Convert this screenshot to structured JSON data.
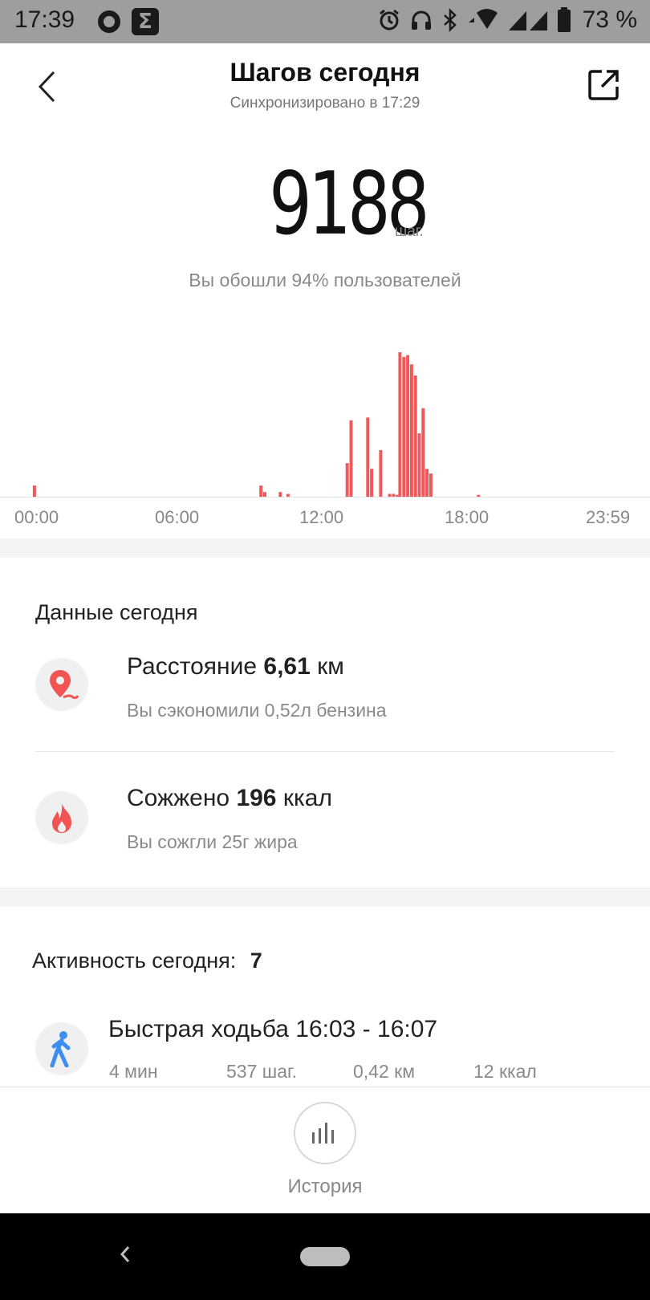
{
  "status_bar": {
    "time": "17:39",
    "battery": "73 %",
    "icons": [
      "ring-app-icon",
      "sigma-app-icon",
      "alarm-icon",
      "headphones-icon",
      "bluetooth-icon",
      "wifi-icon",
      "signal-icon",
      "battery-icon"
    ]
  },
  "header": {
    "title": "Шагов сегодня",
    "subtitle": "Синхронизировано в 17:29",
    "back_icon": "chevron-left-icon",
    "share_icon": "share-icon"
  },
  "steps": {
    "value": "9188",
    "unit": "шаг.",
    "percentile_text": "Вы обошли 94% пользователей"
  },
  "colors": {
    "bar": "#f0595b",
    "accent_red": "#f25454",
    "walk_blue": "#3d8ef0"
  },
  "chart_data": {
    "type": "bar",
    "x_labels": [
      "00:00",
      "06:00",
      "12:00",
      "18:00",
      "23:59"
    ],
    "x_unit": "hour of day",
    "xlim": [
      0,
      24
    ],
    "bars": [
      {
        "x": 0.65,
        "v": 12
      },
      {
        "x": 9.45,
        "v": 12
      },
      {
        "x": 9.6,
        "v": 5
      },
      {
        "x": 10.2,
        "v": 5
      },
      {
        "x": 10.5,
        "v": 3
      },
      {
        "x": 12.8,
        "v": 36
      },
      {
        "x": 12.95,
        "v": 82
      },
      {
        "x": 13.6,
        "v": 85
      },
      {
        "x": 13.75,
        "v": 30
      },
      {
        "x": 14.1,
        "v": 50
      },
      {
        "x": 14.45,
        "v": 3
      },
      {
        "x": 14.6,
        "v": 3
      },
      {
        "x": 14.75,
        "v": 2
      },
      {
        "x": 14.85,
        "v": 155
      },
      {
        "x": 15.0,
        "v": 150
      },
      {
        "x": 15.15,
        "v": 152
      },
      {
        "x": 15.3,
        "v": 142
      },
      {
        "x": 15.45,
        "v": 130
      },
      {
        "x": 15.6,
        "v": 68
      },
      {
        "x": 15.75,
        "v": 95
      },
      {
        "x": 15.9,
        "v": 30
      },
      {
        "x": 16.05,
        "v": 25
      },
      {
        "x": 17.9,
        "v": 2
      }
    ]
  },
  "today_data": {
    "title": "Данные сегодня",
    "distance": {
      "icon": "location-pin-icon",
      "prefix": "Расстояние",
      "value": "6,61",
      "unit": "км",
      "sub": "Вы сэкономили 0,52л бензина"
    },
    "calories": {
      "icon": "flame-icon",
      "prefix": "Сожжено",
      "value": "196",
      "unit": "ккал",
      "sub": "Вы сожгли 25г жира"
    }
  },
  "activity": {
    "title": "Активность сегодня:",
    "count": "7",
    "item": {
      "icon": "walking-person-icon",
      "title": "Быстрая ходьба 16:03 - 16:07",
      "duration": "4 мин",
      "steps": "537 шаг.",
      "distance": "0,42 км",
      "calories": "12 ккал"
    }
  },
  "bottom": {
    "history_label": "История",
    "history_icon": "bar-chart-icon"
  }
}
